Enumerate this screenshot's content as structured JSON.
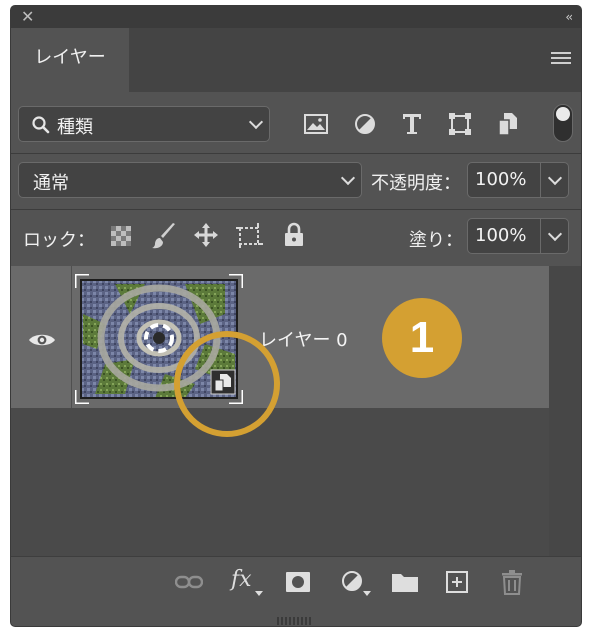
{
  "panel": {
    "tab_label": "レイヤー",
    "collapse_glyph": "‹‹",
    "close_glyph": "✕"
  },
  "filter": {
    "kind_label": "種類",
    "icons": [
      "pixel-layer-filter-icon",
      "adjustment-layer-filter-icon",
      "type-layer-filter-icon",
      "shape-layer-filter-icon",
      "smart-object-filter-icon"
    ]
  },
  "blend": {
    "mode_label": "通常",
    "opacity_label": "不透明度：",
    "opacity_value": "100%"
  },
  "lock": {
    "lock_label": "ロック：",
    "fill_label": "塗り：",
    "fill_value": "100%"
  },
  "layers": [
    {
      "name": "レイヤー 0",
      "visible": true,
      "type": "smart-object"
    }
  ],
  "annotation": {
    "badge_number": "1",
    "color": "#D4A032"
  },
  "bottom_icons": [
    "link-layers-icon",
    "fx-icon",
    "add-mask-icon",
    "adjustment-layer-icon",
    "new-group-icon",
    "new-layer-icon",
    "delete-layer-icon"
  ],
  "fx_label": "fx"
}
